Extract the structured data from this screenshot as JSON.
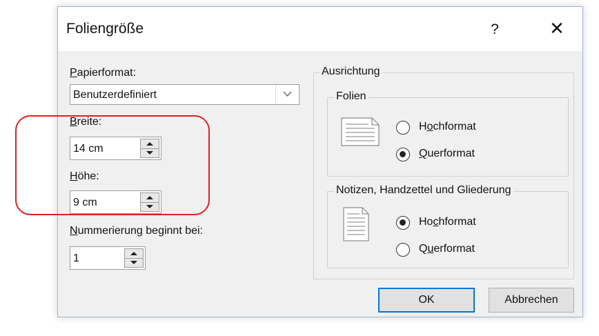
{
  "dialog": {
    "title": "Foliengröße",
    "help_label": "?",
    "close_label": "✕"
  },
  "papierformat": {
    "label_first": "P",
    "label_rest": "apierformat:",
    "value": "Benutzerdefiniert"
  },
  "breite": {
    "label_first": "B",
    "label_rest": "reite:",
    "value": "14 cm"
  },
  "hoehe": {
    "label_first": "H",
    "label_rest": "öhe:",
    "value": "9 cm"
  },
  "nummerierung": {
    "label_first": "N",
    "label_rest": "ummerierung beginnt bei:",
    "value": "1"
  },
  "ausrichtung": {
    "title": "Ausrichtung",
    "folien": {
      "title": "Folien",
      "options": [
        {
          "pre": "H",
          "ul": "o",
          "post": "chformat",
          "selected": false
        },
        {
          "pre": "",
          "ul": "Q",
          "post": "uerformat",
          "selected": true
        }
      ]
    },
    "notizen": {
      "title": "Notizen, Handzettel und Gliederung",
      "options": [
        {
          "pre": "Ho",
          "ul": "c",
          "post": "hformat",
          "selected": true
        },
        {
          "pre": "Q",
          "ul": "u",
          "post": "erformat",
          "selected": false
        }
      ]
    }
  },
  "buttons": {
    "ok": "OK",
    "cancel": "Abbrechen"
  },
  "colors": {
    "highlight": "#e02020",
    "default_button_border": "#0078d7"
  }
}
